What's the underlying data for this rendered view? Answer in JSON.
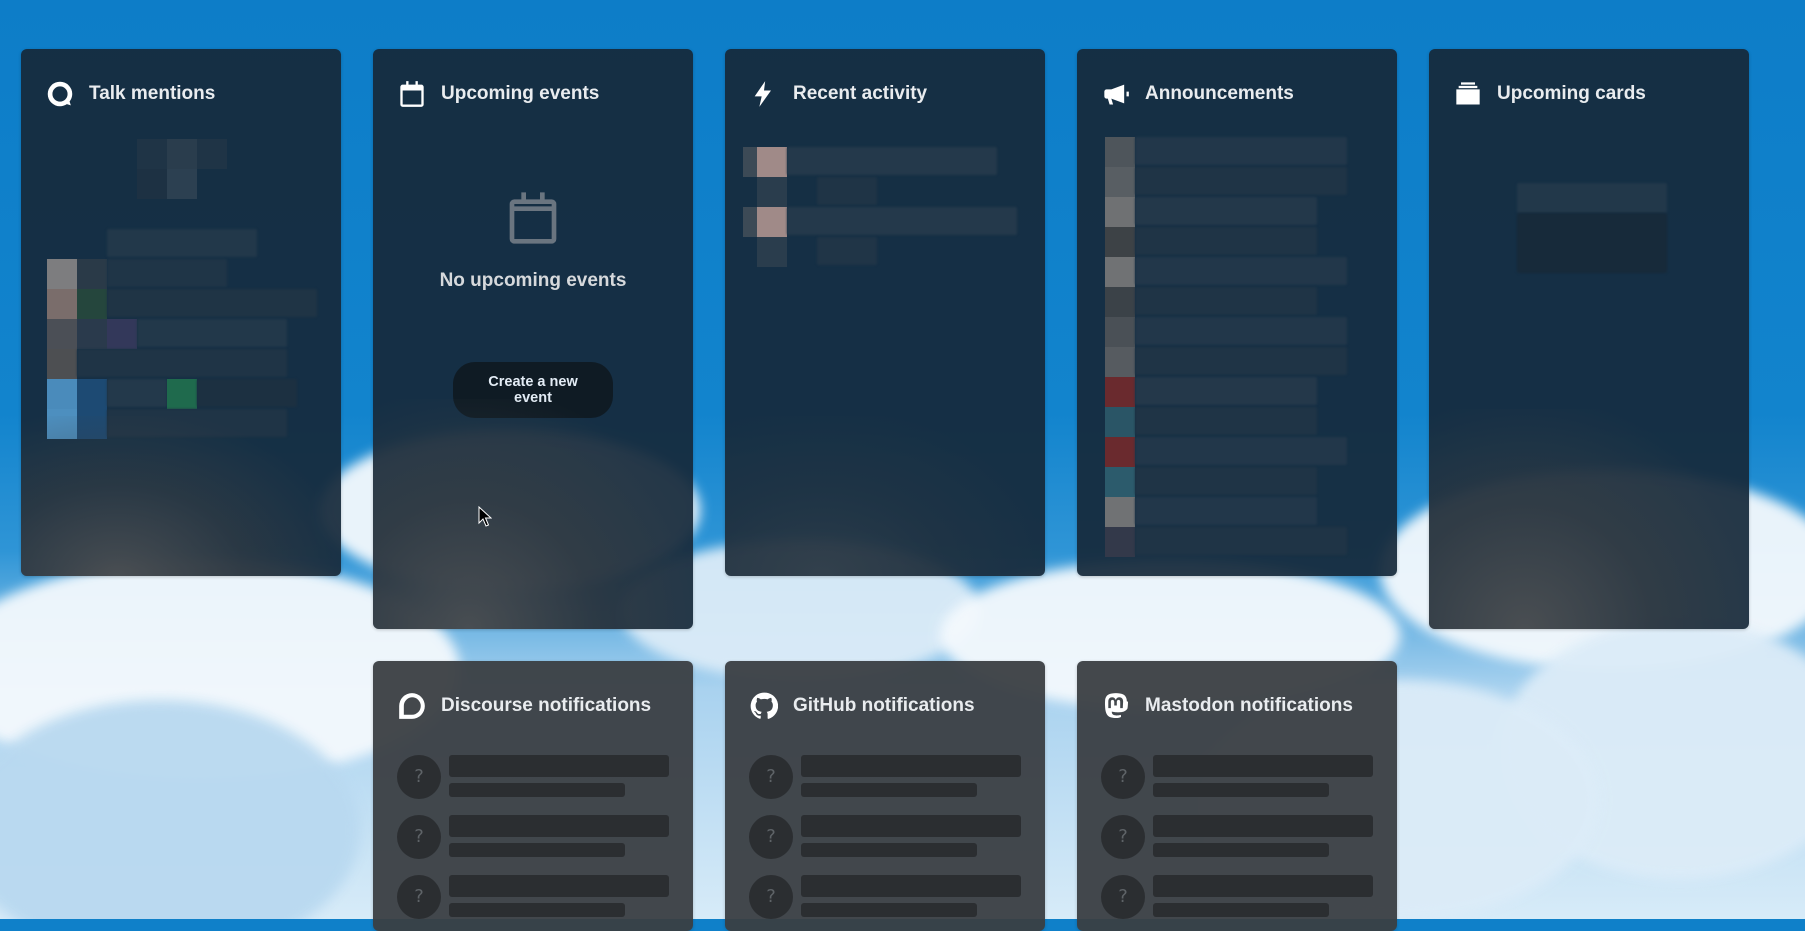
{
  "widgets": {
    "talk": {
      "title": "Talk mentions",
      "icon": "talk-icon"
    },
    "events": {
      "title": "Upcoming events",
      "icon": "calendar-icon",
      "empty_message": "No upcoming events",
      "create_label": "Create a new event"
    },
    "activity": {
      "title": "Recent activity",
      "icon": "lightning-icon"
    },
    "announcements": {
      "title": "Announcements",
      "icon": "megaphone-icon"
    },
    "cards": {
      "title": "Upcoming cards",
      "icon": "cards-stack-icon"
    },
    "discourse": {
      "title": "Discourse notifications",
      "icon": "discourse-icon",
      "placeholder_items": [
        {
          "avatar": "?"
        },
        {
          "avatar": "?"
        },
        {
          "avatar": "?"
        }
      ]
    },
    "github": {
      "title": "GitHub notifications",
      "icon": "github-icon",
      "placeholder_items": [
        {
          "avatar": "?"
        },
        {
          "avatar": "?"
        },
        {
          "avatar": "?"
        }
      ]
    },
    "mastodon": {
      "title": "Mastodon notifications",
      "icon": "mastodon-icon",
      "placeholder_items": [
        {
          "avatar": "?"
        },
        {
          "avatar": "?"
        },
        {
          "avatar": "?"
        }
      ]
    }
  },
  "colors": {
    "background_sky": "#0f80c9",
    "widget_dark": "#16293a",
    "widget_grey": "#3a3e42",
    "button_bg": "#0f1b24"
  }
}
